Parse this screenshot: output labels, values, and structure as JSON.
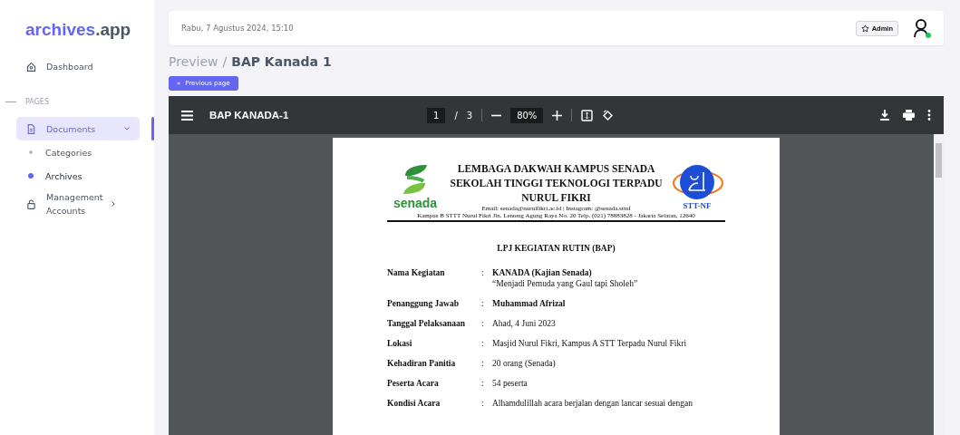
{
  "sidebar": {
    "logo": {
      "brand": "archives",
      "suffix": ".app"
    },
    "items": [
      {
        "label": "Dashboard",
        "selected": false
      },
      {
        "kind": "section",
        "label": "PAGES"
      },
      {
        "label": "Documents",
        "selected": true,
        "expanded": true,
        "children": [
          {
            "label": "Categories",
            "selected": false
          },
          {
            "label": "Archives",
            "selected": true
          }
        ]
      },
      {
        "label": "Management Accounts",
        "selected": false,
        "expanded": false
      }
    ]
  },
  "header": {
    "datetime": "Rabu, 7 Agustus 2024, 15:10",
    "role_badge": "Admin",
    "user_online": true
  },
  "breadcrumb": {
    "parent": "Preview",
    "separator": "/",
    "current": "BAP Kanada 1"
  },
  "back_button": {
    "icon": "«",
    "label": "Previous page"
  },
  "viewer": {
    "title": "BAP KANADA-1",
    "page": "1",
    "separator": "/",
    "pages": "3",
    "zoom": "80%"
  },
  "document": {
    "left_logo_text": "senada",
    "right_logo_text": "STT-NF",
    "letterhead": [
      "LEMBAGA DAKWAH KAMPUS SENADA",
      "SEKOLAH TINGGI TEKNOLOGI TERPADU",
      "NURUL FIKRI"
    ],
    "contact": "Email: senada@nurulfikri.ac.id | Instagram: @senada.sttnf",
    "address": "Kampus B STTT Nurul Fikri Jln. Lenteng Agung Raya No. 20 Telp. (021) 78883828 - Jakarta Selatan, 12640",
    "heading": "LPJ KEGIATAN RUTIN (BAP)",
    "colon": ":",
    "fields": [
      {
        "label": "Nama Kegiatan",
        "lines": [
          "KANADA (Kajian Senada)",
          "“Menjadi Pemuda yang Gaul tapi Sholeh”"
        ],
        "bold_first": true
      },
      {
        "label": "Penanggung Jawab",
        "lines": [
          "Muhammad Afrizal"
        ],
        "bold_first": true
      },
      {
        "label": "Tanggal Pelaksanaan",
        "lines": [
          "Ahad, 4 Juni 2023"
        ],
        "bold_first": false
      },
      {
        "label": "Lokasi",
        "lines": [
          "Masjid Nurul Fikri, Kampus A STT Terpadu Nurul Fikri"
        ],
        "bold_first": false
      },
      {
        "label": "Kehadiran Panitia",
        "lines": [
          "20 orang (Senada)"
        ],
        "bold_first": false
      },
      {
        "label": "Peserta Acara",
        "lines": [
          "54 peserta"
        ],
        "bold_first": false
      },
      {
        "label": "Kondisi Acara",
        "lines": [
          "Alhamdulillah acara berjalan dengan lancar sesuai dengan"
        ],
        "bold_first": false
      }
    ]
  }
}
